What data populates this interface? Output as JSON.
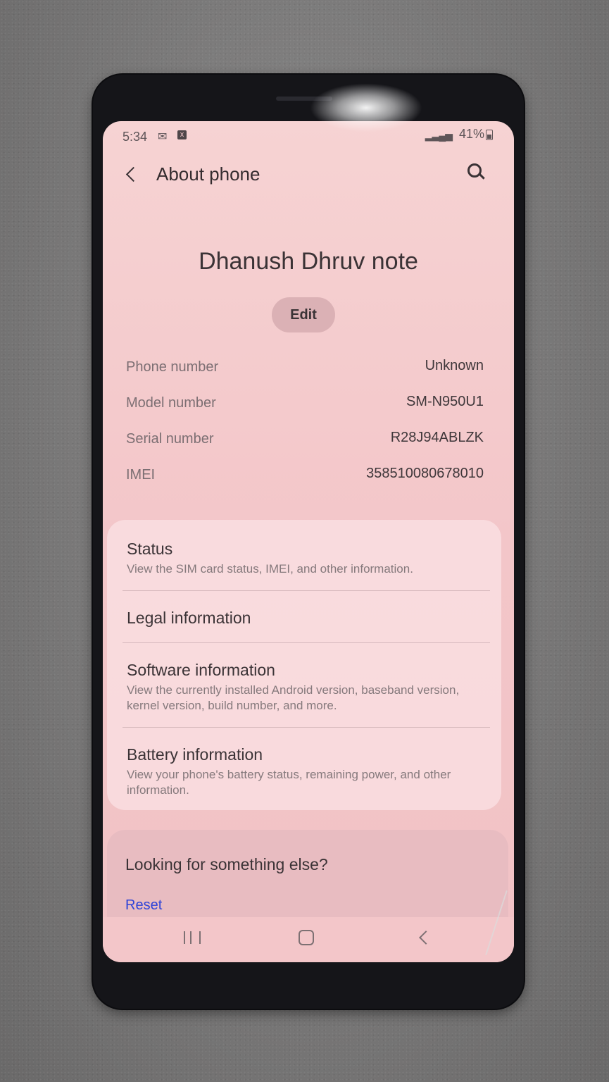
{
  "status_bar": {
    "time": "5:34",
    "notif_icon_a": "✉",
    "notif_icon_b": "x",
    "signal": "▂▃▄▅",
    "battery": "41%"
  },
  "app_bar": {
    "title": "About phone"
  },
  "device": {
    "name": "Dhanush Dhruv note",
    "edit_label": "Edit"
  },
  "info": [
    {
      "label": "Phone number",
      "value": "Unknown"
    },
    {
      "label": "Model number",
      "value": "SM-N950U1"
    },
    {
      "label": "Serial number",
      "value": "R28J94ABLZK"
    },
    {
      "label": "IMEI",
      "value": "358510080678010"
    }
  ],
  "menu": [
    {
      "title": "Status",
      "subtitle": "View the SIM card status, IMEI, and other information."
    },
    {
      "title": "Legal information",
      "subtitle": ""
    },
    {
      "title": "Software information",
      "subtitle": "View the currently installed Android version, baseband version, kernel version, build number, and more."
    },
    {
      "title": "Battery information",
      "subtitle": "View your phone's battery status, remaining power, and other information."
    }
  ],
  "suggest": {
    "title": "Looking for something else?",
    "reset_label": "Reset"
  },
  "icons": {
    "back": "back-arrow-icon",
    "search": "search-icon",
    "nav_recent": "recent-apps-icon",
    "nav_home": "home-icon",
    "nav_back": "nav-back-icon"
  },
  "colors": {
    "screen_tint": "#f3c6c9",
    "link": "#2d43d8",
    "edit_button": "#dbb1b5"
  }
}
